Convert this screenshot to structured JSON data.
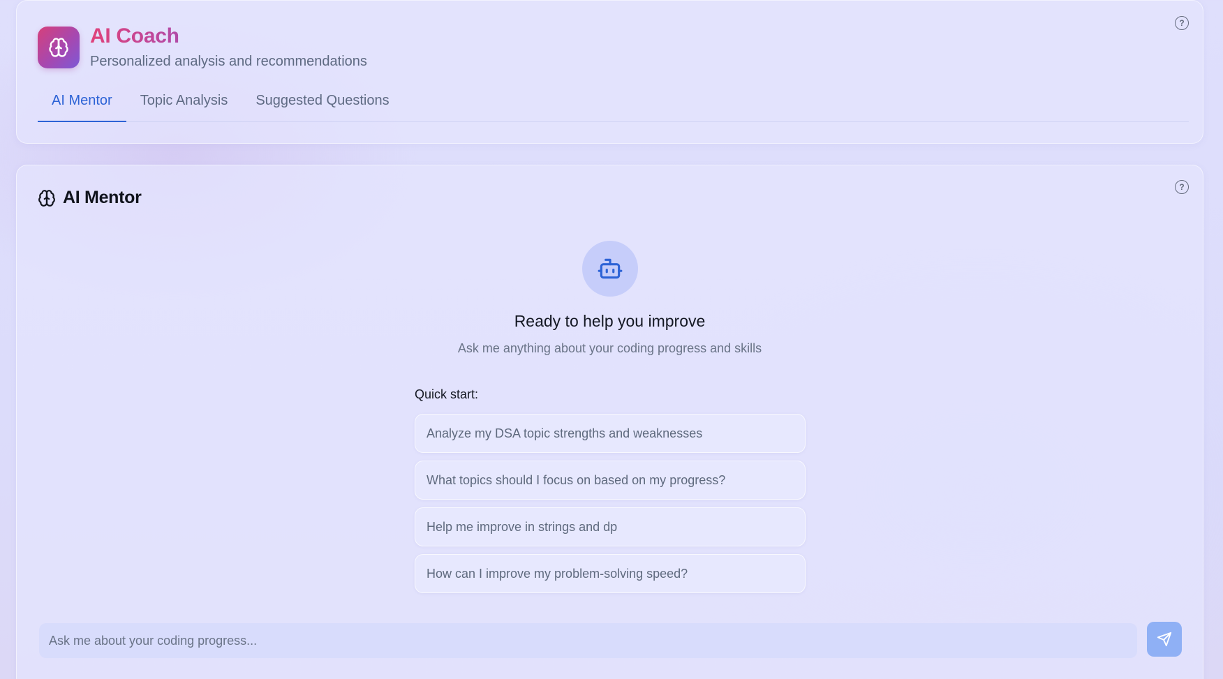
{
  "header": {
    "title": "AI Coach",
    "subtitle": "Personalized analysis and recommendations",
    "logo_icon": "brain-icon",
    "help_icon": "help-circle-icon",
    "tabs": [
      {
        "label": "AI Mentor",
        "active": true
      },
      {
        "label": "Topic Analysis",
        "active": false
      },
      {
        "label": "Suggested Questions",
        "active": false
      }
    ]
  },
  "mentor": {
    "title": "AI Mentor",
    "title_icon": "brain-icon",
    "avatar_icon": "bot-icon",
    "ready_title": "Ready to help you improve",
    "ready_subtitle": "Ask me anything about your coding progress and skills",
    "quick_start_label": "Quick start:",
    "quick_start": [
      "Analyze my DSA topic strengths and weaknesses",
      "What topics should I focus on based on my progress?",
      "Help me improve in strings and dp",
      "How can I improve my problem-solving speed?"
    ],
    "input_placeholder": "Ask me about your coding progress...",
    "input_value": "",
    "send_icon": "send-icon"
  },
  "colors": {
    "accent": "#2d63d6",
    "brand_gradient_start": "#e0417a",
    "brand_gradient_end": "#7d59d6",
    "send_button": "#8fb0f5"
  }
}
